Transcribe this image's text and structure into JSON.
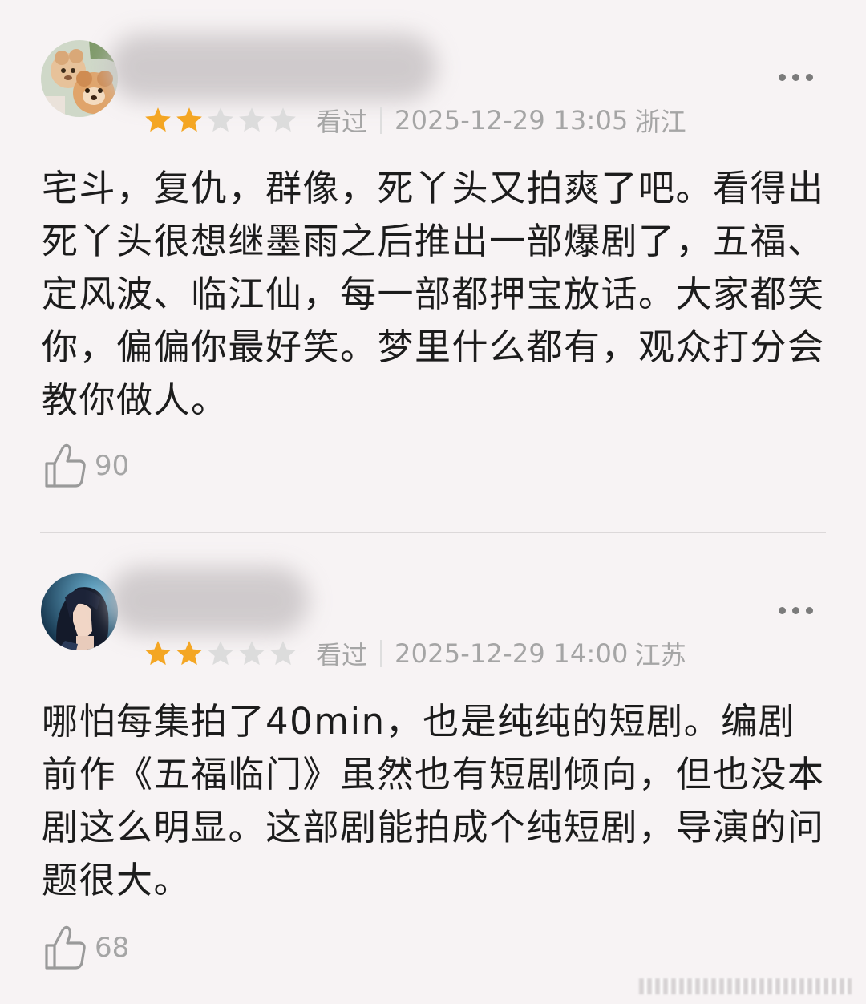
{
  "colors": {
    "star_filled": "#f4a623",
    "star_empty": "#dcdcdc",
    "muted_text": "#a5a5a5"
  },
  "reviews": [
    {
      "rating": 2,
      "max_rating": 5,
      "status": "看过",
      "datetime": "2025-12-29 13:05",
      "location": "浙江",
      "content": "宅斗，复仇，群像，死丫头又拍爽了吧。看得出死丫头很想继墨雨之后推出一部爆剧了，五福、定风波、临江仙，每一部都押宝放话。大家都笑你，偏偏你最好笑。梦里什么都有，观众打分会教你做人。",
      "likes": "90"
    },
    {
      "rating": 2,
      "max_rating": 5,
      "status": "看过",
      "datetime": "2025-12-29 14:00",
      "location": "江苏",
      "content": "哪怕每集拍了40min，也是纯纯的短剧。编剧前作《五福临门》虽然也有短剧倾向，但也没本剧这么明显。这部剧能拍成个纯短剧，导演的问题很大。",
      "likes": "68"
    }
  ]
}
